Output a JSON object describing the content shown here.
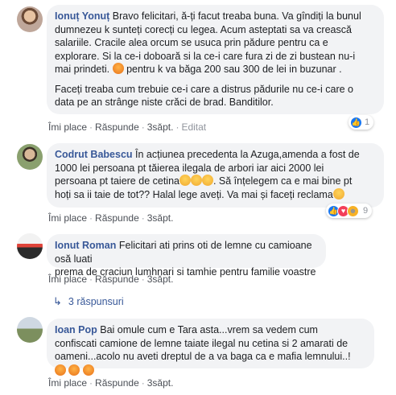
{
  "comments": [
    {
      "author": "Ionuț Yonuț",
      "text_lines": [
        "Bravo felicitari, ă-ți facut treaba buna. Va gîndiți la bunul",
        "dumnezeu k sunteți corecți cu legea. Acum asteptati sa va crească",
        "salariile. Cracile alea orcum se usuca prin pădure pentru ca e",
        "explorare. Si la ce-i doboară si la ce-i care fura zi de zi bustean nu-i",
        "mai prindeti.",
        "pentru k va băga 200 sau 300 de lei in buzunar .",
        "Faceți treaba cum trebuie ce-i care a distrus pădurile nu ce-i care o",
        "data pe an strânge niste crăci de brad. Banditilor."
      ],
      "like_label": "Îmi place",
      "reply_label": "Răspunde",
      "time": "3săpt.",
      "edited_label": "Editat",
      "reaction_count": "1",
      "reactions": [
        "like"
      ]
    },
    {
      "author": "Codrut Babescu",
      "text_lines": [
        "În acțiunea precedenta la Azuga,amenda a fost de",
        "1000 lei persoana pt tăierea ilegala de arbori iar aici 2000 lei",
        "persoana pt taiere de cetina",
        "Să înțelegem ca e mai bine pt",
        "hoți sa ii taie de tot?? Halal lege aveți. Va mai și faceți reclama"
      ],
      "like_label": "Îmi place",
      "reply_label": "Răspunde",
      "time": "3săpt.",
      "reaction_count": "9",
      "reactions": [
        "like",
        "love",
        "haha"
      ]
    },
    {
      "author": "Ionut Roman",
      "text_lines": [
        "Felicitari ati prins oti de lemne cu camioane osă luati",
        "prema de craciun lumhnari si tamhie pentru familie voastre"
      ],
      "like_label": "Îmi place",
      "reply_label": "Răspunde",
      "time": "3săpt."
    },
    {
      "author": "Ioan Pop",
      "text_lines": [
        "Bai omule cum e Tara asta...vrem sa vedem cum",
        "confiscati camione de lemne taiate ilegal nu cetina si 2 amarati de",
        "oameni...acolo nu aveti dreptul de a va baga ca e mafia lemnului..!"
      ],
      "like_label": "Îmi place",
      "reply_label": "Răspunde",
      "time": "3săpt."
    }
  ],
  "replies_link": "3 răspunsuri",
  "colors": {
    "name": "#385898",
    "bubble": "#f2f3f5",
    "meta": "#90949c",
    "like": "#1877f2"
  }
}
